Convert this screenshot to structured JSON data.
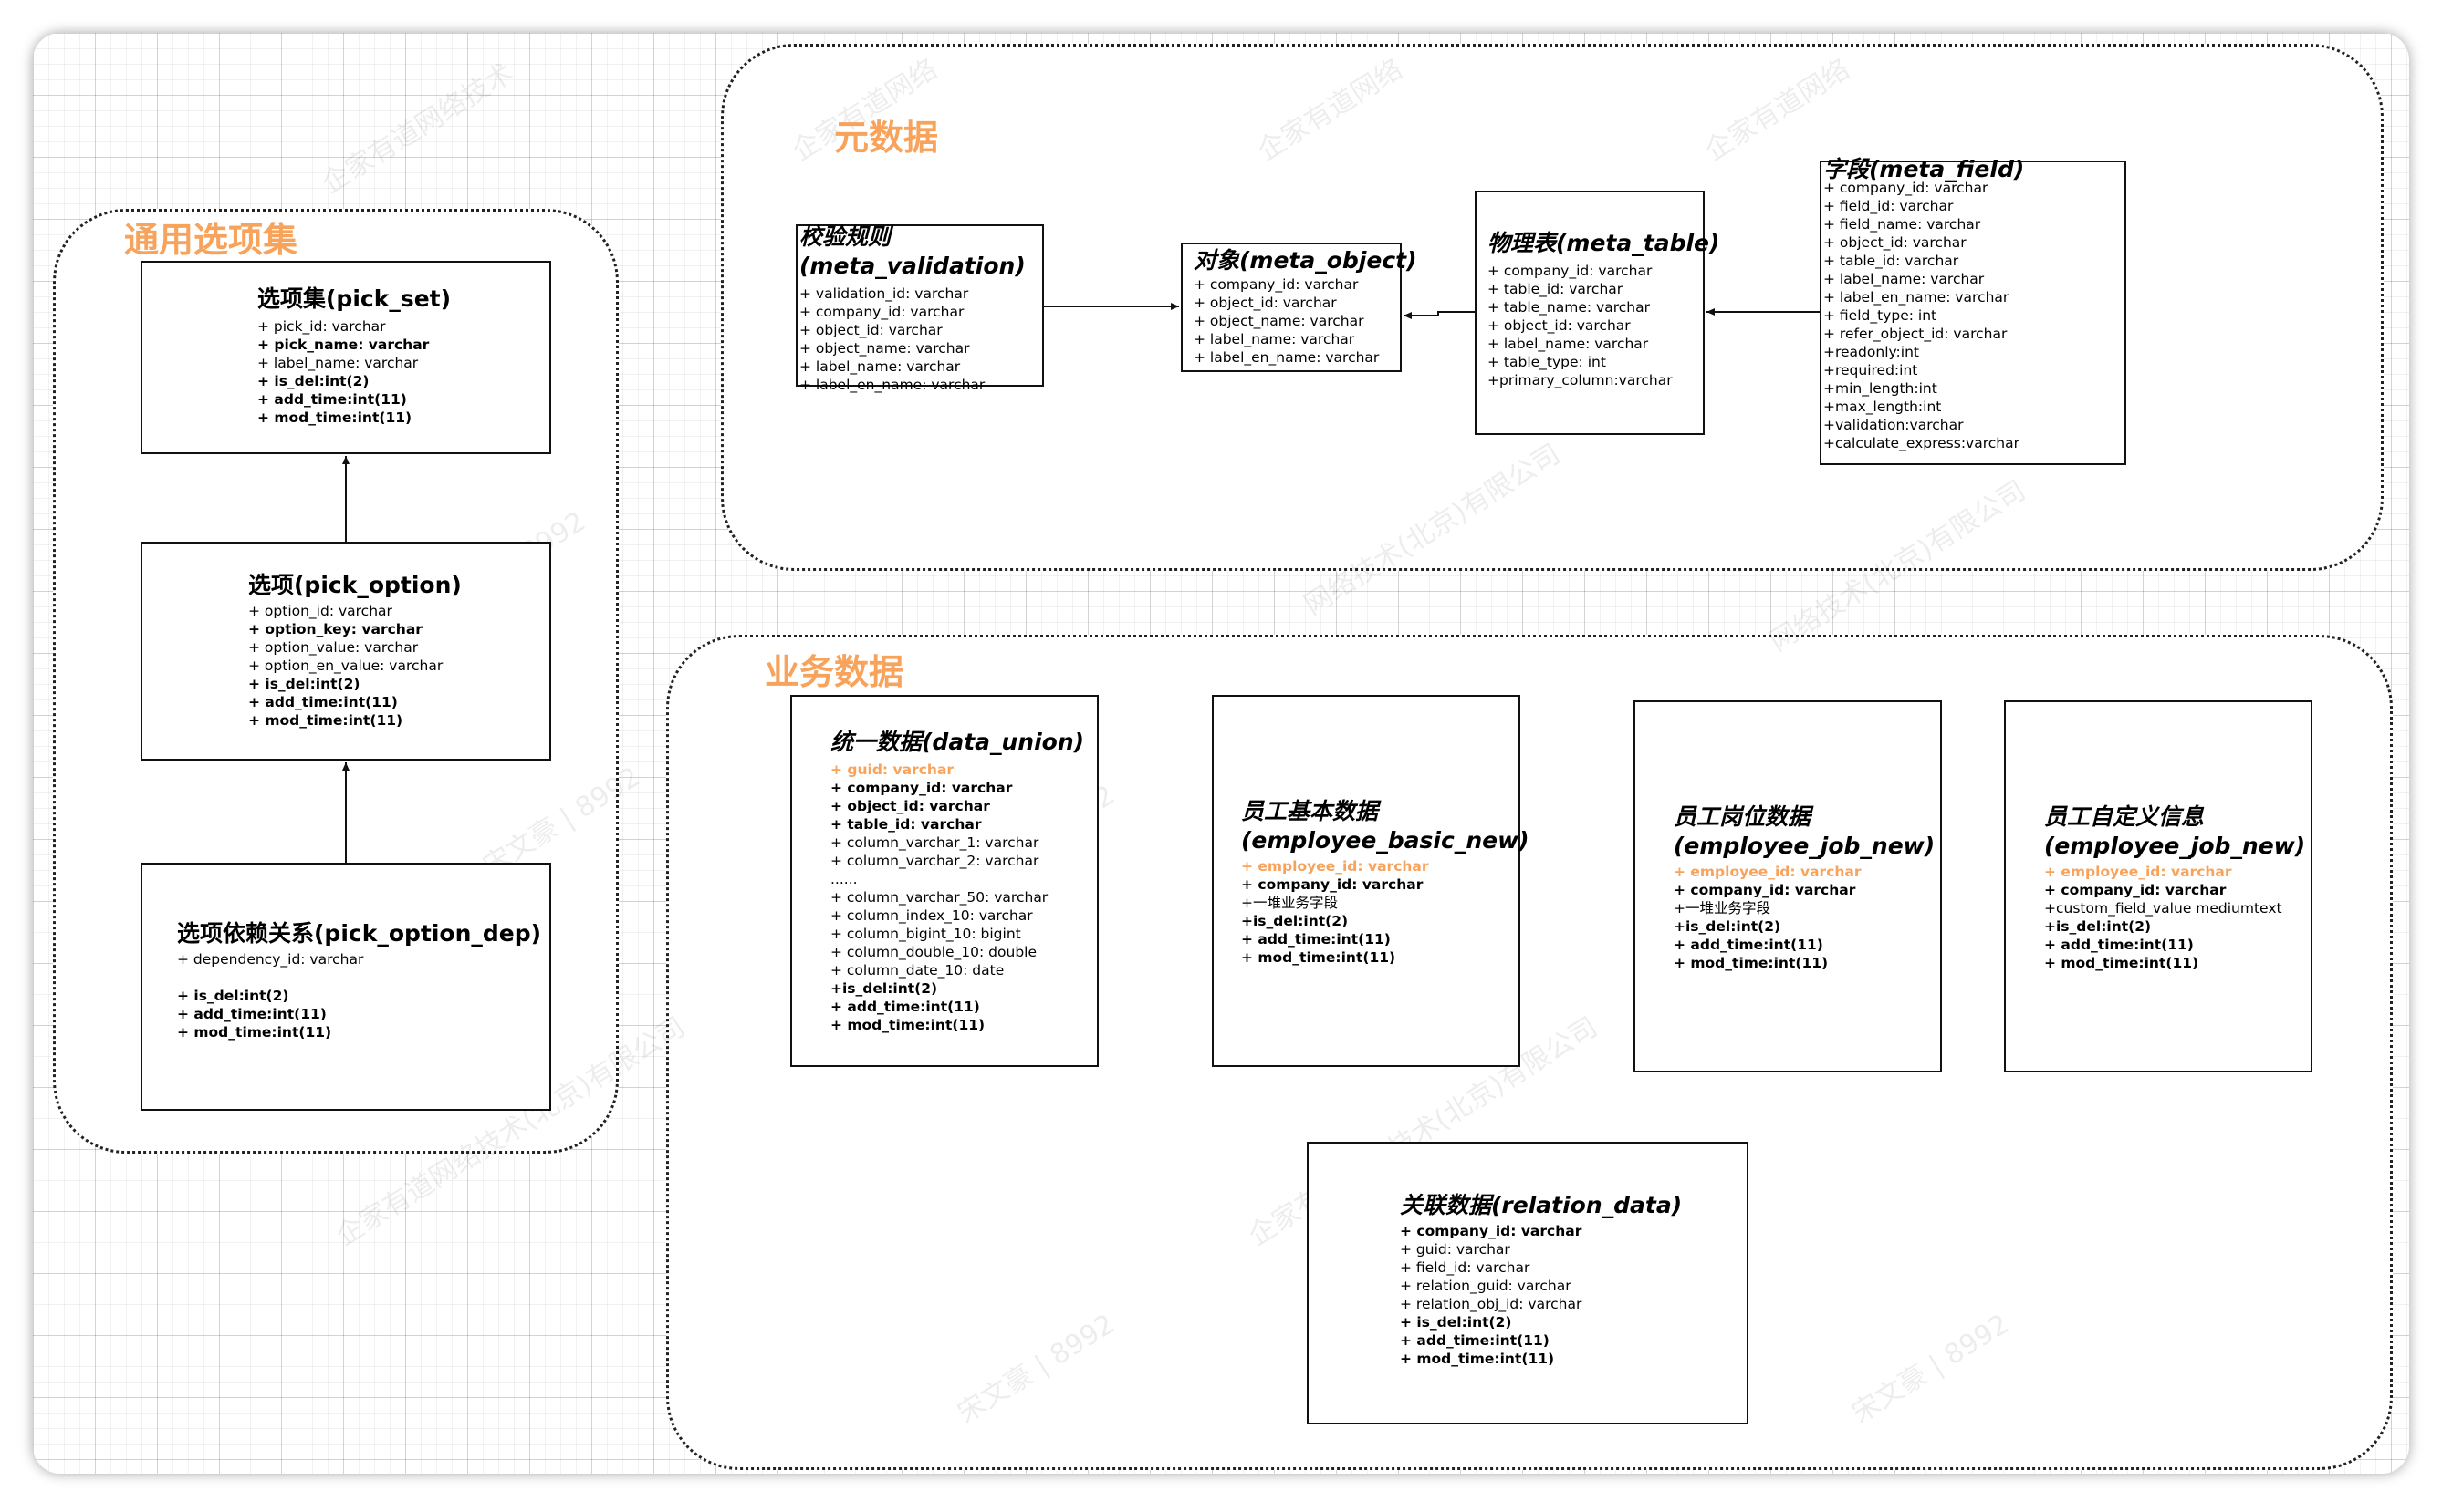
{
  "groups": {
    "common": {
      "title": "通用选项集"
    },
    "meta": {
      "title": "元数据"
    },
    "business": {
      "title": "业务数据"
    }
  },
  "colors": {
    "accent": "#f7a35c",
    "border": "#111111",
    "grid": "#e6e6e6"
  },
  "tables": {
    "pick_set": {
      "title": "选项集(pick_set)",
      "fields": [
        {
          "text": "+ pick_id: varchar",
          "bold": false
        },
        {
          "text": "+ pick_name: varchar",
          "bold": true
        },
        {
          "text": "+ label_name: varchar",
          "bold": false
        },
        {
          "text": "+ is_del:int(2)",
          "bold": true
        },
        {
          "text": "+ add_time:int(11)",
          "bold": true
        },
        {
          "text": "+ mod_time:int(11)",
          "bold": true
        }
      ]
    },
    "pick_option": {
      "title": "选项(pick_option)",
      "fields": [
        {
          "text": "+ option_id: varchar",
          "bold": false
        },
        {
          "text": "+ option_key: varchar",
          "bold": true
        },
        {
          "text": "+ option_value: varchar",
          "bold": false
        },
        {
          "text": "+ option_en_value: varchar",
          "bold": false
        },
        {
          "text": "+ is_del:int(2)",
          "bold": true
        },
        {
          "text": "+ add_time:int(11)",
          "bold": true
        },
        {
          "text": "+ mod_time:int(11)",
          "bold": true
        }
      ]
    },
    "pick_option_dep": {
      "title": "选项依赖关系(pick_option_dep)",
      "fields": [
        {
          "text": "+ dependency_id: varchar",
          "bold": false
        },
        {
          "text": "",
          "bold": false
        },
        {
          "text": "+ is_del:int(2)",
          "bold": true
        },
        {
          "text": "+ add_time:int(11)",
          "bold": true
        },
        {
          "text": "+ mod_time:int(11)",
          "bold": true
        }
      ]
    },
    "meta_validation": {
      "title": "校验规则\n(meta_validation)",
      "fields": [
        {
          "text": "+ validation_id: varchar",
          "bold": false
        },
        {
          "text": "+ company_id: varchar",
          "bold": false
        },
        {
          "text": "+ object_id: varchar",
          "bold": false
        },
        {
          "text": "+ object_name: varchar",
          "bold": false
        },
        {
          "text": "+ label_name: varchar",
          "bold": false
        },
        {
          "text": "+ label_en_name: varchar",
          "bold": false
        }
      ]
    },
    "meta_object": {
      "title": "对象(meta_object)",
      "fields": [
        {
          "text": "+ company_id: varchar",
          "bold": false
        },
        {
          "text": "+ object_id: varchar",
          "bold": false
        },
        {
          "text": "+ object_name: varchar",
          "bold": false
        },
        {
          "text": "+ label_name: varchar",
          "bold": false
        },
        {
          "text": "+ label_en_name: varchar",
          "bold": false
        }
      ]
    },
    "meta_table": {
      "title": "物理表(meta_table)",
      "fields": [
        {
          "text": "+ company_id: varchar",
          "bold": false
        },
        {
          "text": "+ table_id: varchar",
          "bold": false
        },
        {
          "text": "+ table_name: varchar",
          "bold": false
        },
        {
          "text": "+ object_id: varchar",
          "bold": false
        },
        {
          "text": "+ label_name: varchar",
          "bold": false
        },
        {
          "text": "+ table_type: int",
          "bold": false
        },
        {
          "text": "+primary_column:varchar",
          "bold": false
        }
      ]
    },
    "meta_field": {
      "title": "字段(meta_field)",
      "fields": [
        {
          "text": "+ company_id: varchar",
          "bold": false
        },
        {
          "text": "+ field_id: varchar",
          "bold": false
        },
        {
          "text": "+ field_name: varchar",
          "bold": false
        },
        {
          "text": "+ object_id: varchar",
          "bold": false
        },
        {
          "text": "+ table_id: varchar",
          "bold": false
        },
        {
          "text": "+ label_name: varchar",
          "bold": false
        },
        {
          "text": "+ label_en_name: varchar",
          "bold": false
        },
        {
          "text": "+ field_type: int",
          "bold": false
        },
        {
          "text": "+ refer_object_id: varchar",
          "bold": false
        },
        {
          "text": "+readonly:int",
          "bold": false
        },
        {
          "text": "+required:int",
          "bold": false
        },
        {
          "text": "+min_length:int",
          "bold": false
        },
        {
          "text": "+max_length:int",
          "bold": false
        },
        {
          "text": "+validation:varchar",
          "bold": false
        },
        {
          "text": "+calculate_express:varchar",
          "bold": false
        }
      ]
    },
    "data_union": {
      "title": "统一数据(data_union)",
      "fields": [
        {
          "text": "+ guid: varchar",
          "bold": true,
          "orange": true
        },
        {
          "text": "+ company_id: varchar",
          "bold": true
        },
        {
          "text": "+ object_id: varchar",
          "bold": true
        },
        {
          "text": "+ table_id: varchar",
          "bold": true
        },
        {
          "text": "+ column_varchar_1: varchar",
          "bold": false
        },
        {
          "text": "+ column_varchar_2: varchar",
          "bold": false
        },
        {
          "text": "......",
          "bold": false
        },
        {
          "text": "+ column_varchar_50: varchar",
          "bold": false
        },
        {
          "text": "+ column_index_10: varchar",
          "bold": false
        },
        {
          "text": "+ column_bigint_10: bigint",
          "bold": false
        },
        {
          "text": "+ column_double_10: double",
          "bold": false
        },
        {
          "text": "+ column_date_10: date",
          "bold": false
        },
        {
          "text": "+is_del:int(2)",
          "bold": true
        },
        {
          "text": "+ add_time:int(11)",
          "bold": true
        },
        {
          "text": "+ mod_time:int(11)",
          "bold": true
        }
      ]
    },
    "employee_basic_new": {
      "title": "员工基本数据\n(employee_basic_new)",
      "fields": [
        {
          "text": "+ employee_id: varchar",
          "bold": true,
          "orange": true
        },
        {
          "text": "+ company_id: varchar",
          "bold": true
        },
        {
          "text": "+一堆业务字段",
          "bold": false
        },
        {
          "text": "+is_del:int(2)",
          "bold": true
        },
        {
          "text": "+ add_time:int(11)",
          "bold": true
        },
        {
          "text": "+ mod_time:int(11)",
          "bold": true
        }
      ]
    },
    "employee_job_new": {
      "title": "员工岗位数据\n(employee_job_new)",
      "fields": [
        {
          "text": "+ employee_id: varchar",
          "bold": true,
          "orange": true
        },
        {
          "text": "+ company_id: varchar",
          "bold": true
        },
        {
          "text": "+一堆业务字段",
          "bold": false
        },
        {
          "text": "+is_del:int(2)",
          "bold": true
        },
        {
          "text": "+ add_time:int(11)",
          "bold": true
        },
        {
          "text": "+ mod_time:int(11)",
          "bold": true
        }
      ]
    },
    "employee_custom": {
      "title": "员工自定义信息\n(employee_job_new)",
      "fields": [
        {
          "text": "+ employee_id: varchar",
          "bold": true,
          "orange": true
        },
        {
          "text": "+ company_id: varchar",
          "bold": true
        },
        {
          "text": "+custom_field_value mediumtext",
          "bold": false
        },
        {
          "text": "+is_del:int(2)",
          "bold": true
        },
        {
          "text": "+ add_time:int(11)",
          "bold": true
        },
        {
          "text": "+ mod_time:int(11)",
          "bold": true
        }
      ]
    },
    "relation_data": {
      "title": "关联数据(relation_data)",
      "fields": [
        {
          "text": "+ company_id: varchar",
          "bold": true
        },
        {
          "text": "+ guid: varchar",
          "bold": false
        },
        {
          "text": "+ field_id: varchar",
          "bold": false
        },
        {
          "text": "+ relation_guid: varchar",
          "bold": false
        },
        {
          "text": "+ relation_obj_id: varchar",
          "bold": false
        },
        {
          "text": "+ is_del:int(2)",
          "bold": true
        },
        {
          "text": "+ add_time:int(11)",
          "bold": true
        },
        {
          "text": "+ mod_time:int(11)",
          "bold": true
        }
      ]
    }
  }
}
